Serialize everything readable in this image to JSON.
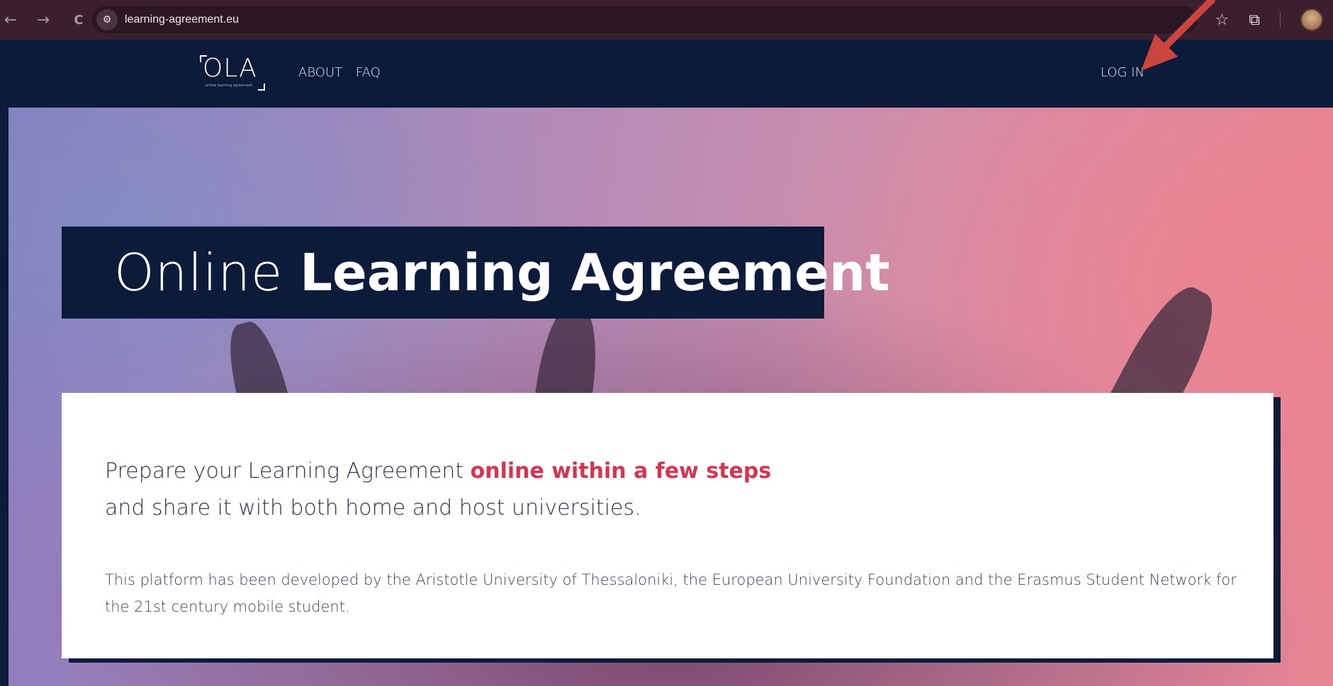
{
  "browser": {
    "back": "←",
    "forward": "→",
    "reload": "C",
    "url": "learning-agreement.eu",
    "star": "☆",
    "extensions": "⧉"
  },
  "header": {
    "logo_text": "OLA",
    "logo_tagline": "online learning agreement",
    "nav": [
      {
        "label": "ABOUT"
      },
      {
        "label": "FAQ"
      }
    ],
    "login": "LOG IN"
  },
  "hero": {
    "title_light": "Online ",
    "title_bold": "Learning Agreement"
  },
  "card": {
    "lead_part1": "Prepare your Learning Agreement ",
    "lead_accent": "online within a few steps",
    "lead_part2": "and share it with both home and host universities.",
    "description": "This platform has been developed by the Aristotle University of Thessaloniki, the European University Foundation and the Erasmus Student Network for the 21st century mobile student."
  },
  "colors": {
    "navy": "#0d1b3a",
    "accent": "#d6344f",
    "annotation_arrow": "#c9453e"
  }
}
